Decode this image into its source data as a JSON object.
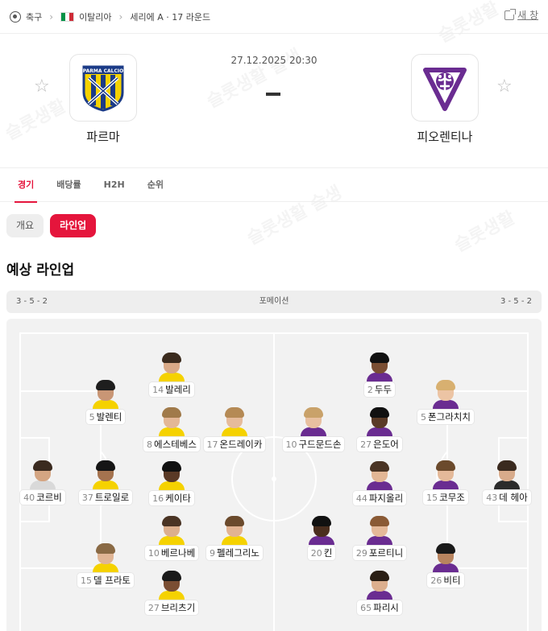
{
  "breadcrumb": {
    "sport": "축구",
    "country": "이탈리아",
    "league": "세리에 A · 17 라운드",
    "new_window": "새 창",
    "icons": [
      "soccer-ball-icon",
      "chevron-right-icon",
      "italy-flag-icon",
      "external-link-icon"
    ],
    "flag_colors": [
      "#009246",
      "#ffffff",
      "#ce2b37"
    ]
  },
  "match": {
    "datetime": "27.12.2025 20:30",
    "score_placeholder": "-",
    "home": {
      "name": "파르마",
      "crest_colors": [
        "#1b3b87",
        "#f5d200"
      ]
    },
    "away": {
      "name": "피오렌티나",
      "crest_colors": [
        "#6a2c91",
        "#ffffff"
      ]
    }
  },
  "tabs": [
    {
      "label": "경기",
      "active": true
    },
    {
      "label": "배당률",
      "active": false
    },
    {
      "label": "H2H",
      "active": false
    },
    {
      "label": "순위",
      "active": false
    }
  ],
  "subtabs": [
    {
      "label": "개요",
      "active": false
    },
    {
      "label": "라인업",
      "active": true
    }
  ],
  "lineup": {
    "title": "예상 라인업",
    "formation_label": "포메이션",
    "home_formation": "3 - 5 - 2",
    "away_formation": "3 - 5 - 2",
    "home_players": [
      {
        "number": "40",
        "name": "코르비"
      },
      {
        "number": "5",
        "name": "발렌티"
      },
      {
        "number": "37",
        "name": "트로일로"
      },
      {
        "number": "15",
        "name": "델 프라토"
      },
      {
        "number": "14",
        "name": "발레리"
      },
      {
        "number": "8",
        "name": "에스테베스"
      },
      {
        "number": "16",
        "name": "케이타"
      },
      {
        "number": "10",
        "name": "베르나베"
      },
      {
        "number": "27",
        "name": "브리츠기"
      },
      {
        "number": "17",
        "name": "온드레이카"
      },
      {
        "number": "9",
        "name": "펠레그리노"
      }
    ],
    "away_players": [
      {
        "number": "43",
        "name": "데 헤아"
      },
      {
        "number": "5",
        "name": "폰그라치치"
      },
      {
        "number": "15",
        "name": "코무조"
      },
      {
        "number": "26",
        "name": "비티"
      },
      {
        "number": "2",
        "name": "두두"
      },
      {
        "number": "27",
        "name": "은도어"
      },
      {
        "number": "44",
        "name": "파지올리"
      },
      {
        "number": "29",
        "name": "포르티니"
      },
      {
        "number": "65",
        "name": "파리시"
      },
      {
        "number": "10",
        "name": "구드문드손"
      },
      {
        "number": "20",
        "name": "킨"
      }
    ]
  },
  "colors": {
    "accent": "#e5153c"
  }
}
